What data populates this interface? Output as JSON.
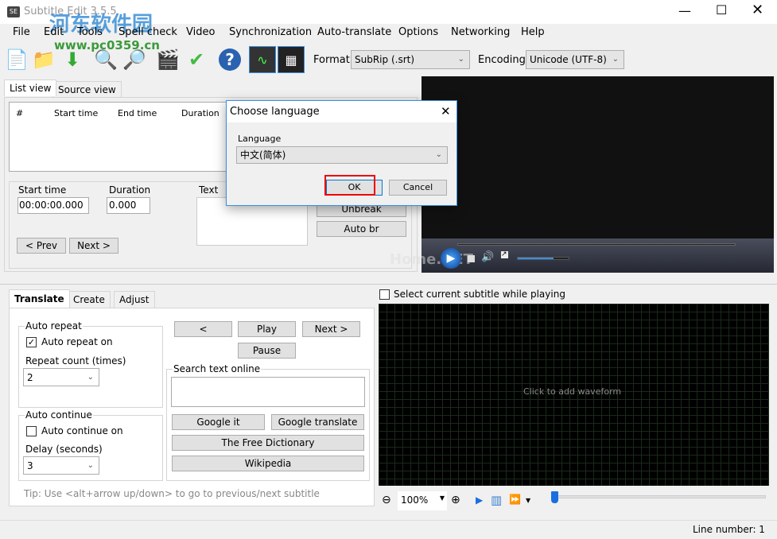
{
  "window": {
    "title": "Subtitle Edit 3.5.5",
    "logo_text": "SE",
    "watermark": "河东软件园",
    "watermark_url": "www.pc0359.cn"
  },
  "menu": [
    "File",
    "Edit",
    "Tools",
    "Spell check",
    "Video",
    "Synchronization",
    "Auto-translate",
    "Options",
    "Networking",
    "Help"
  ],
  "toolbar": {
    "format_label": "Format",
    "format_value": "SubRip (.srt)",
    "encoding_label": "Encoding",
    "encoding_value": "Unicode (UTF-8)"
  },
  "list": {
    "tabs": [
      "List view",
      "Source view"
    ],
    "columns": [
      "#",
      "Start time",
      "End time",
      "Duration"
    ]
  },
  "editor": {
    "start_label": "Start time",
    "start_value": "00:00:00.000",
    "duration_label": "Duration",
    "duration_value": "0.000",
    "text_label": "Text",
    "prev": "< Prev",
    "next": "Next >",
    "unbreak": "Unbreak",
    "auto_br": "Auto br"
  },
  "dialog": {
    "title": "Choose language",
    "language_label": "Language",
    "language_value": "中文(简体)",
    "ok": "OK",
    "cancel": "Cancel"
  },
  "player": {
    "watermark": "Home.NET",
    "volume_percent": 70
  },
  "waveform": {
    "select_label": "Select current subtitle while playing",
    "hint": "Click to add waveform",
    "zoom": "100%"
  },
  "bottom": {
    "tabs": [
      "Translate",
      "Create",
      "Adjust"
    ],
    "auto_repeat": "Auto repeat",
    "auto_repeat_on": "Auto repeat on",
    "repeat_count_label": "Repeat count (times)",
    "repeat_count": "2",
    "auto_continue": "Auto continue",
    "auto_continue_on": "Auto continue on",
    "delay_label": "Delay (seconds)",
    "delay": "3",
    "prev": "<",
    "play": "Play",
    "next": "Next >",
    "pause": "Pause",
    "search_label": "Search text online",
    "google_it": "Google it",
    "google_translate": "Google translate",
    "free_dict": "The Free Dictionary",
    "wikipedia": "Wikipedia",
    "tip": "Tip: Use <alt+arrow up/down> to go to previous/next subtitle"
  },
  "status": {
    "line_number": "Line number: 1"
  }
}
